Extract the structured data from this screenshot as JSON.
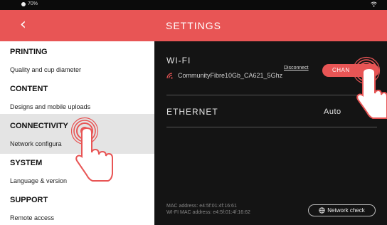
{
  "status_bar": {
    "battery": "70%",
    "battery_icon": "battery-icon",
    "wifi_icon": "wifi-icon"
  },
  "header": {
    "back_glyph": "‹",
    "title": "SETTINGS",
    "color": "#e85555"
  },
  "sidebar": {
    "groups": [
      {
        "title": "PRINTING",
        "item": "Quality and cup diameter"
      },
      {
        "title": "CONTENT",
        "item": "Designs and mobile uploads"
      },
      {
        "title": "CONNECTIVITY",
        "item": "Network configura"
      },
      {
        "title": "SYSTEM",
        "item": "Language & version"
      },
      {
        "title": "SUPPORT",
        "item": "Remote access"
      }
    ],
    "selected": "CONNECTIVITY"
  },
  "main": {
    "wifi_title": "WI-FI",
    "network_name": "CommunityFibre10Gb_CA621_5Ghz",
    "disconnect_label": "Disconnect",
    "change_label": "CHAN",
    "ethernet_title": "ETHERNET",
    "ethernet_value": "Auto",
    "mac_address": "MAC address: e4:5f:01:4f:16:61",
    "wifi_mac_address": "WI-FI MAC address: e4:5f:01:4f:16:62",
    "network_check_label": "Network check"
  },
  "overlays": {
    "hand_icon": "pointing-hand-icon",
    "tap_ripple_icon": "tap-ripple-icon"
  }
}
